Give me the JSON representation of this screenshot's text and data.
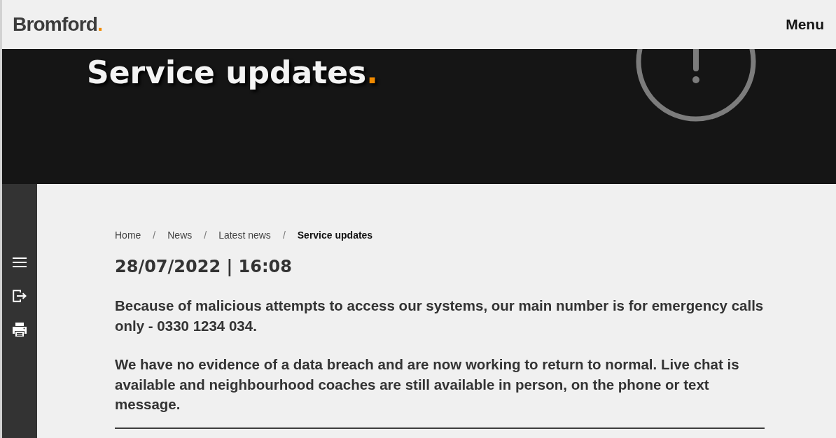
{
  "header": {
    "logo": {
      "text": "Bromford",
      "accent": "."
    },
    "menu": "Menu"
  },
  "hero": {
    "title": "Service updates",
    "accent": "."
  },
  "sidebar": {
    "tools": [
      {
        "kind": "menu"
      },
      {
        "kind": "export"
      },
      {
        "kind": "print"
      }
    ]
  },
  "breadcrumb": [
    {
      "kind": "link",
      "text": "Home"
    },
    {
      "kind": "separator",
      "text": "/"
    },
    {
      "kind": "link",
      "text": "News"
    },
    {
      "kind": "separator",
      "text": "/"
    },
    {
      "kind": "link",
      "text": "Latest news"
    },
    {
      "kind": "separator",
      "text": "/"
    },
    {
      "kind": "current",
      "text": "Service updates"
    }
  ],
  "article": {
    "date": "28/07/2022 | 16:08",
    "paragraphs": [
      "Because of malicious attempts to access our systems, our main number is for emergency calls only - 0330 1234 034.",
      "We have no evidence of a data breach and are now working to return to normal. Live chat is available and neighbourhood coaches are still available in person, on the phone or text message."
    ]
  }
}
